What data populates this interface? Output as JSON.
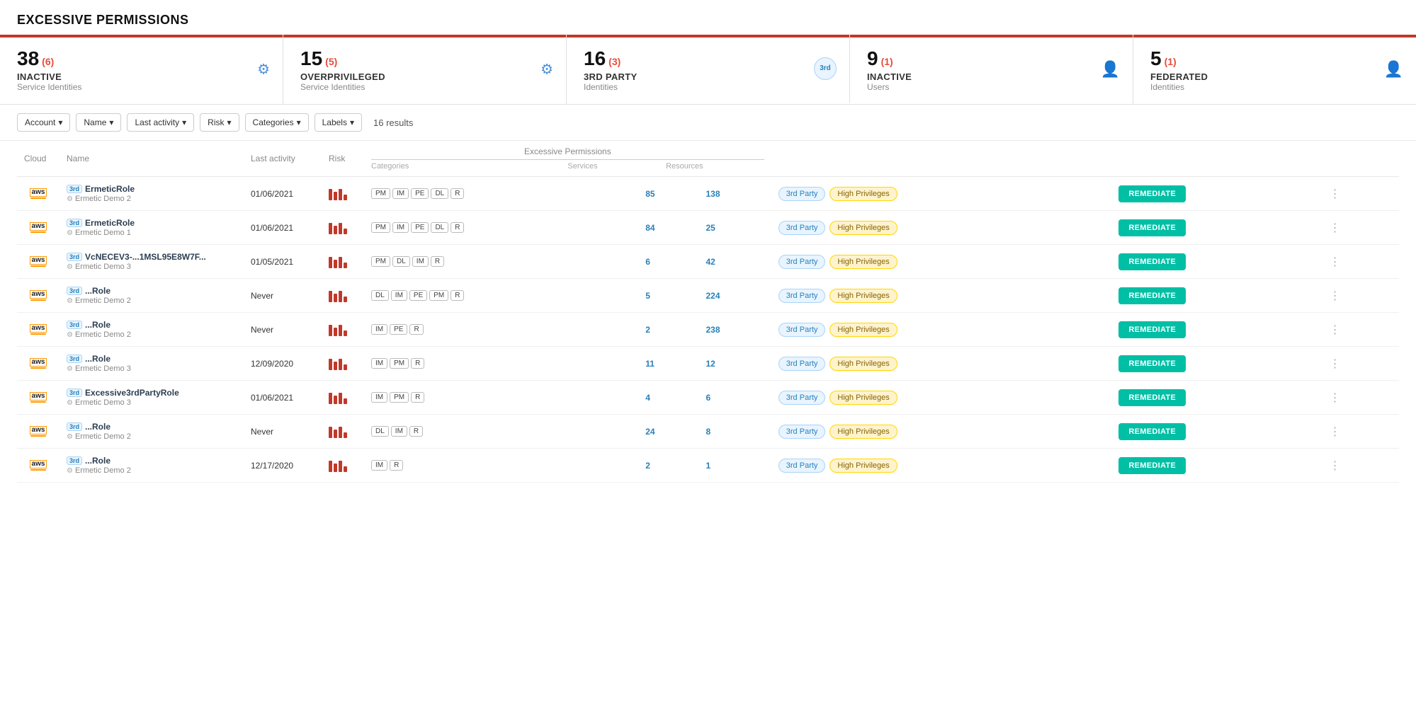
{
  "page": {
    "title": "EXCESSIVE PERMISSIONS"
  },
  "cards": [
    {
      "id": "inactive-si",
      "number": "38",
      "sub": "(6)",
      "label": "INACTIVE",
      "sublabel": "Service Identities",
      "icon": "gear",
      "active": false
    },
    {
      "id": "overprivileged-si",
      "number": "15",
      "sub": "(5)",
      "label": "OVERPRIVILEGED",
      "sublabel": "Service Identities",
      "icon": "gear",
      "active": false
    },
    {
      "id": "3rd-party",
      "number": "16",
      "sub": "(3)",
      "label": "3rd PARTY",
      "sublabel": "Identities",
      "icon": "3rd",
      "active": true
    },
    {
      "id": "inactive-users",
      "number": "9",
      "sub": "(1)",
      "label": "INACTIVE",
      "sublabel": "Users",
      "icon": "user",
      "active": false
    },
    {
      "id": "federated",
      "number": "5",
      "sub": "(1)",
      "label": "FEDERATED",
      "sublabel": "Identities",
      "icon": "user",
      "active": false
    }
  ],
  "filters": {
    "account_label": "Account",
    "name_label": "Name",
    "last_activity_label": "Last activity",
    "risk_label": "Risk",
    "categories_label": "Categories",
    "labels_label": "Labels",
    "results": "16 results"
  },
  "table": {
    "col_cloud": "Cloud",
    "col_name": "Name",
    "col_last": "Last activity",
    "col_risk": "Risk",
    "col_cats": "Categories",
    "col_svc": "Services",
    "col_res": "Resources",
    "ep_header": "Excessive Permissions",
    "rows": [
      {
        "cloud": "aws",
        "name_primary": "ErmeticRole",
        "name_secondary": "Ermetic Demo 2",
        "blurred": false,
        "last_activity": "01/06/2021",
        "risk_bars": [
          4,
          3,
          4,
          2
        ],
        "categories": [
          "PM",
          "IM",
          "PE",
          "DL",
          "R"
        ],
        "services": "85",
        "resources": "138",
        "tag1": "3rd Party",
        "tag2": "High Privileges"
      },
      {
        "cloud": "aws",
        "name_primary": "ErmeticRole",
        "name_secondary": "Ermetic Demo 1",
        "blurred": false,
        "last_activity": "01/06/2021",
        "risk_bars": [
          4,
          3,
          4,
          2
        ],
        "categories": [
          "PM",
          "IM",
          "PE",
          "DL",
          "R"
        ],
        "services": "84",
        "resources": "25",
        "tag1": "3rd Party",
        "tag2": "High Privileges"
      },
      {
        "cloud": "aws",
        "name_primary": "VcNECEV3-...1MSL95E8W7F...",
        "name_secondary": "Ermetic Demo 3",
        "blurred": true,
        "last_activity": "01/05/2021",
        "risk_bars": [
          4,
          3,
          4,
          2
        ],
        "categories": [
          "PM",
          "DL",
          "IM",
          "R"
        ],
        "services": "6",
        "resources": "42",
        "tag1": "3rd Party",
        "tag2": "High Privileges"
      },
      {
        "cloud": "aws",
        "name_primary": "...Role",
        "name_secondary": "Ermetic Demo 2",
        "blurred": true,
        "last_activity": "Never",
        "risk_bars": [
          4,
          3,
          4,
          2
        ],
        "categories": [
          "DL",
          "IM",
          "PE",
          "PM",
          "R"
        ],
        "services": "5",
        "resources": "224",
        "tag1": "3rd Party",
        "tag2": "High Privileges"
      },
      {
        "cloud": "aws",
        "name_primary": "...Role",
        "name_secondary": "Ermetic Demo 2",
        "blurred": true,
        "last_activity": "Never",
        "risk_bars": [
          4,
          3,
          4,
          2
        ],
        "categories": [
          "IM",
          "PE",
          "R"
        ],
        "services": "2",
        "resources": "238",
        "tag1": "3rd Party",
        "tag2": "High Privileges"
      },
      {
        "cloud": "aws",
        "name_primary": "...Role",
        "name_secondary": "Ermetic Demo 3",
        "blurred": true,
        "last_activity": "12/09/2020",
        "risk_bars": [
          4,
          3,
          4,
          2
        ],
        "categories": [
          "IM",
          "PM",
          "R"
        ],
        "services": "11",
        "resources": "12",
        "tag1": "3rd Party",
        "tag2": "High Privileges"
      },
      {
        "cloud": "aws",
        "name_primary": "Excessive3rdPartyRole",
        "name_secondary": "Ermetic Demo 3",
        "blurred": false,
        "last_activity": "01/06/2021",
        "risk_bars": [
          4,
          3,
          4,
          2
        ],
        "categories": [
          "IM",
          "PM",
          "R"
        ],
        "services": "4",
        "resources": "6",
        "tag1": "3rd Party",
        "tag2": "High Privileges"
      },
      {
        "cloud": "aws",
        "name_primary": "...Role",
        "name_secondary": "Ermetic Demo 2",
        "blurred": true,
        "last_activity": "Never",
        "risk_bars": [
          4,
          3,
          4,
          2
        ],
        "categories": [
          "DL",
          "IM",
          "R"
        ],
        "services": "24",
        "resources": "8",
        "tag1": "3rd Party",
        "tag2": "High Privileges"
      },
      {
        "cloud": "aws",
        "name_primary": "...Role",
        "name_secondary": "Ermetic Demo 2",
        "blurred": true,
        "last_activity": "12/17/2020",
        "risk_bars": [
          4,
          3,
          4,
          2
        ],
        "categories": [
          "IM",
          "R"
        ],
        "services": "2",
        "resources": "1",
        "tag1": "3rd Party",
        "tag2": "High Privileges"
      }
    ]
  }
}
